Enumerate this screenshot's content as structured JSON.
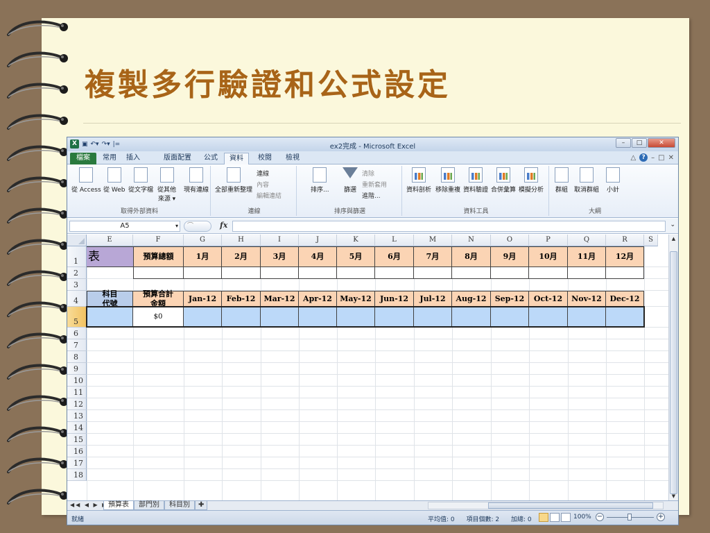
{
  "slide": {
    "title": "複製多行驗證和公式設定"
  },
  "window": {
    "title": "ex2完成 - Microsoft Excel",
    "logo": "X",
    "qat_glyphs": [
      "▣",
      "↶▾",
      "↷▾",
      "|="
    ],
    "controls": [
      "–",
      "□",
      "✕"
    ]
  },
  "tabs": [
    "檔案",
    "常用",
    "插入",
    "版面配置",
    "公式",
    "資料",
    "校閱",
    "檢視"
  ],
  "help_glyphs": [
    "△",
    "?",
    "–",
    "□",
    "✕"
  ],
  "ribbon": {
    "groups": [
      {
        "label": "取得外部資料",
        "buttons": [
          "從 Access",
          "從 Web",
          "從文字檔",
          "從其他\n來源 ▾",
          "現有連線"
        ]
      },
      {
        "label": "連線",
        "buttons": [
          "全部重新整理"
        ],
        "small": [
          "連線",
          "內容",
          "編輯連結"
        ]
      },
      {
        "label": "排序與篩選",
        "buttons": [
          "排序...",
          "篩選"
        ],
        "small": [
          "清除",
          "重新套用",
          "進階..."
        ]
      },
      {
        "label": "資料工具",
        "buttons": [
          "資料剖析",
          "移除重複",
          "資料驗證",
          "合併彙算",
          "模擬分析"
        ]
      },
      {
        "label": "大綱",
        "buttons": [
          "群組",
          "取消群組",
          "小計"
        ]
      }
    ]
  },
  "formula_bar": {
    "name_box": "A5",
    "fx": "fx",
    "oval": "⌒",
    "value": ""
  },
  "grid": {
    "columns": [
      "E",
      "F",
      "G",
      "H",
      "I",
      "J",
      "K",
      "L",
      "M",
      "N",
      "O",
      "P",
      "Q",
      "R",
      "S"
    ],
    "rows": [
      "1",
      "2",
      "3",
      "4",
      "5",
      "6",
      "7",
      "8",
      "9",
      "10",
      "11",
      "12",
      "13",
      "14",
      "15",
      "16",
      "17",
      "18"
    ],
    "row1": {
      "e": "表",
      "f": "預算總額",
      "months": [
        "1月",
        "2月",
        "3月",
        "4月",
        "5月",
        "6月",
        "7月",
        "8月",
        "9月",
        "10月",
        "11月",
        "12月"
      ]
    },
    "row4": {
      "e": "科目\n代號",
      "f": "預算合計\n金額",
      "months": [
        "Jan-12",
        "Feb-12",
        "Mar-12",
        "Apr-12",
        "May-12",
        "Jun-12",
        "Jul-12",
        "Aug-12",
        "Sep-12",
        "Oct-12",
        "Nov-12",
        "Dec-12"
      ]
    },
    "row5": {
      "f": "$0"
    }
  },
  "sheet_tabs": [
    "預算表",
    "部門別",
    "科目別"
  ],
  "sheet_nav": "◀◀ ◀ ▶ ▶▶",
  "status": {
    "ready": "就緒",
    "average": "平均值: 0",
    "count": "項目個數: 2",
    "sum": "加總: 0",
    "zoom": "100%"
  },
  "colors": {
    "accent_title": "#a86418",
    "header_peach": "#fbd4b4",
    "header_lavender": "#b8a7d6",
    "header_blue": "#b9cdea",
    "selected_row": "#bcd9f9",
    "file_tab": "#2a7a3e"
  }
}
